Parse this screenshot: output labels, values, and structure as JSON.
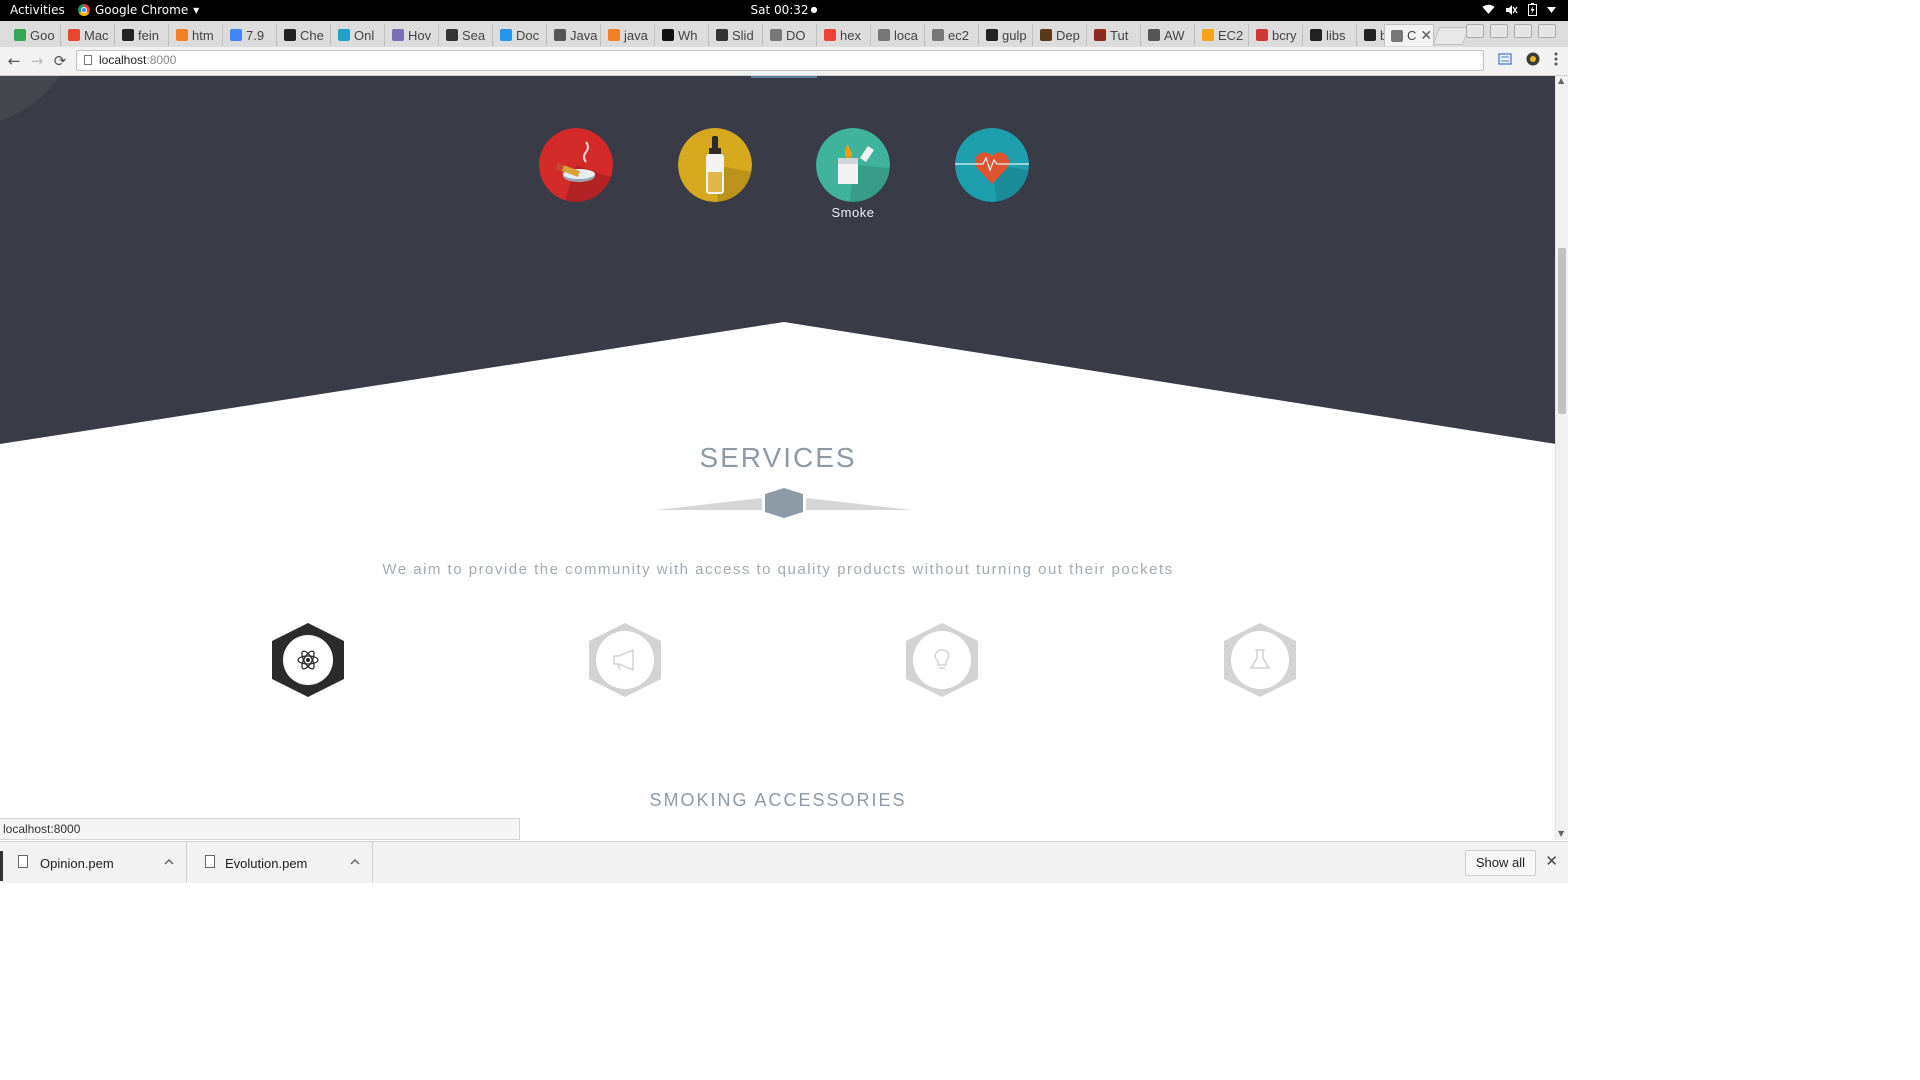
{
  "system_bar": {
    "activities": "Activities",
    "app_name": "Google Chrome",
    "app_menu_arrow": "▾",
    "clock": "Sat 00:32",
    "clock_dot": "●"
  },
  "tabs": [
    {
      "label": "Goo",
      "icon": "google-icon",
      "color": "#34a853"
    },
    {
      "label": "Mac",
      "icon": "slides-icon",
      "color": "#e8442f"
    },
    {
      "label": "fein",
      "icon": "github-icon",
      "color": "#222222"
    },
    {
      "label": "htm",
      "icon": "stackoverflow-icon",
      "color": "#f48024"
    },
    {
      "label": "7.9",
      "icon": "google-icon",
      "color": "#4285f4"
    },
    {
      "label": "Che",
      "icon": "h-icon",
      "color": "#222222"
    },
    {
      "label": "Onl",
      "icon": "cloud-icon",
      "color": "#1fa2c8"
    },
    {
      "label": "Hov",
      "icon": "bars-icon",
      "color": "#7a6fb0"
    },
    {
      "label": "Sea",
      "icon": "rs-icon",
      "color": "#333333"
    },
    {
      "label": "Doc",
      "icon": "docker-icon",
      "color": "#2496ed"
    },
    {
      "label": "Java",
      "icon": "java-icon",
      "color": "#555555"
    },
    {
      "label": "java",
      "icon": "stackoverflow-icon",
      "color": "#f48024"
    },
    {
      "label": "Wh",
      "icon": "p-icon",
      "color": "#111111"
    },
    {
      "label": "Slid",
      "icon": "slides-icon",
      "color": "#333333"
    },
    {
      "label": "DO",
      "icon": "page-icon",
      "color": "#777777"
    },
    {
      "label": "hex",
      "icon": "google-icon",
      "color": "#ea4335"
    },
    {
      "label": "loca",
      "icon": "page-icon",
      "color": "#777777"
    },
    {
      "label": "ec2",
      "icon": "page-icon",
      "color": "#777777"
    },
    {
      "label": "gulp",
      "icon": "github-icon",
      "color": "#222222"
    },
    {
      "label": "Dep",
      "icon": "book-icon",
      "color": "#5a3a1a"
    },
    {
      "label": "Tut",
      "icon": "book-icon",
      "color": "#8b2b1b"
    },
    {
      "label": "AW",
      "icon": "aws-icon",
      "color": "#555555"
    },
    {
      "label": "EC2",
      "icon": "box-icon",
      "color": "#f7a21b"
    },
    {
      "label": "bcry",
      "icon": "npm-icon",
      "color": "#cb3837"
    },
    {
      "label": "libs",
      "icon": "github-icon",
      "color": "#222222"
    },
    {
      "label": "bcry",
      "icon": "github-icon",
      "color": "#222222"
    },
    {
      "label": "C",
      "icon": "page-icon",
      "color": "#777777",
      "active": true
    }
  ],
  "toolbar": {
    "back": "←",
    "forward": "→",
    "reload": "⟳",
    "url_host": "localhost",
    "url_port": ":8000"
  },
  "page": {
    "colors": {
      "dark_band": "#393b47",
      "accent": "#8e9aa6",
      "active_hex": "#2b2b2b",
      "inactive_hex": "#d3d3d3"
    },
    "feature_circles": [
      {
        "name": "ashtray",
        "icon": "ashtray-icon",
        "color": "#d42a2a"
      },
      {
        "name": "eliquid-bottle",
        "icon": "bottle-icon",
        "color": "#d5a81e"
      },
      {
        "name": "lighter",
        "icon": "lighter-icon",
        "color": "#3fb39c",
        "label": "Smoke"
      },
      {
        "name": "heart",
        "icon": "heart-icon",
        "color": "#1e9fad"
      }
    ],
    "services": {
      "title": "SERVICES",
      "subtitle": "We aim to provide the community with access to quality products without turning out their pockets",
      "items": [
        {
          "icon": "atom-icon",
          "active": true
        },
        {
          "icon": "megaphone-icon",
          "active": false
        },
        {
          "icon": "lightbulb-icon",
          "active": false
        },
        {
          "icon": "flask-icon",
          "active": false
        }
      ]
    },
    "accessories_title": "SMOKING ACCESSORIES"
  },
  "status_bubble": "localhost:8000",
  "downloads": {
    "items": [
      {
        "name": "Opinion.pem"
      },
      {
        "name": "Evolution.pem"
      }
    ],
    "show_all": "Show all",
    "close": "✕"
  }
}
